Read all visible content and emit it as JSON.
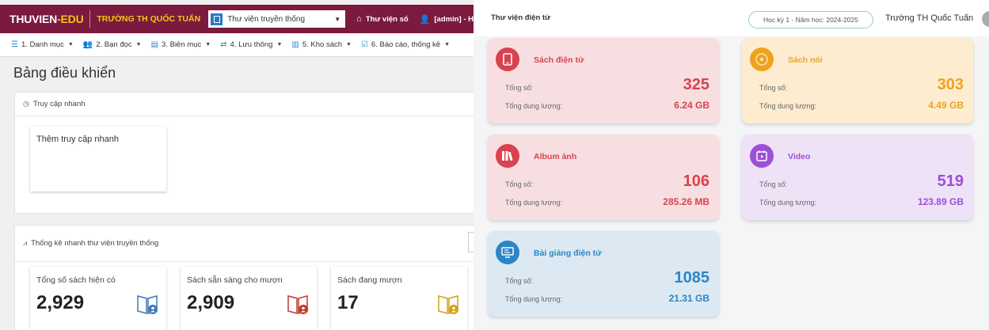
{
  "left": {
    "brand": {
      "main": "THUVIEN",
      "accent": "-EDU"
    },
    "school_name": "TRƯỜNG TH QUỐC TUẤN",
    "library_select": {
      "value": "Thư viện truyền thống"
    },
    "nav": {
      "digital_library": "Thư viện số",
      "user": "[admin] - H"
    },
    "menu": [
      {
        "label": "1. Danh mục",
        "icon": "list-icon"
      },
      {
        "label": "2. Bạn đọc",
        "icon": "readers-icon"
      },
      {
        "label": "3. Biên mục",
        "icon": "catalog-icon"
      },
      {
        "label": "4. Lưu thông",
        "icon": "exchange-icon"
      },
      {
        "label": "5. Kho sách",
        "icon": "warehouse-icon"
      },
      {
        "label": "6. Báo cáo, thống kê",
        "icon": "report-icon"
      }
    ],
    "page_title": "Bảng điều khiển",
    "quick_access": {
      "title": "Truy cập nhanh",
      "tile_label": "Thêm truy cập nhanh"
    },
    "quick_stats": {
      "title": "Thống kê nhanh thư viện truyền thống",
      "tiles": [
        {
          "label": "Tổng số sách hiện có",
          "value": "2,929",
          "color": "#3d7ab8"
        },
        {
          "label": "Sách sẵn sàng cho mượn",
          "value": "2,909",
          "color": "#c0392b"
        },
        {
          "label": "Sách đang mượn",
          "value": "17",
          "color": "#d4a017"
        }
      ]
    },
    "colors": {
      "brand_bar": "#7b1a3e",
      "accent_yellow": "#f5c518",
      "menu_icon": "#2a8fd6"
    }
  },
  "right": {
    "title": "Thư viện điện tử",
    "term": "Học kỳ 1 - Năm học: 2024-2025",
    "school": "Trường TH Quốc Tuấn",
    "total_label": "Tổng số:",
    "size_label": "Tổng dung lượng:",
    "cards": [
      {
        "title": "Sách điện tử",
        "count": "325",
        "size": "6.24 GB",
        "icon": "tablet-icon",
        "bg": "#f7dfe1",
        "accent": "#d9424e"
      },
      {
        "title": "Sách nói",
        "count": "303",
        "size": "4.49 GB",
        "icon": "audio-disc-icon",
        "bg": "#fdecd0",
        "accent": "#f0a21c"
      },
      {
        "title": "Album ảnh",
        "count": "106",
        "size": "285.26 MB",
        "icon": "books-icon",
        "bg": "#f7dfe1",
        "accent": "#d9424e"
      },
      {
        "title": "Video",
        "count": "519",
        "size": "123.89 GB",
        "icon": "video-icon",
        "bg": "#eee2f7",
        "accent": "#9d4fd6"
      },
      {
        "title": "Bài giảng điện tử",
        "count": "1085",
        "size": "21.31 GB",
        "icon": "monitor-icon",
        "bg": "#dce9f2",
        "accent": "#2b86c5"
      }
    ]
  }
}
